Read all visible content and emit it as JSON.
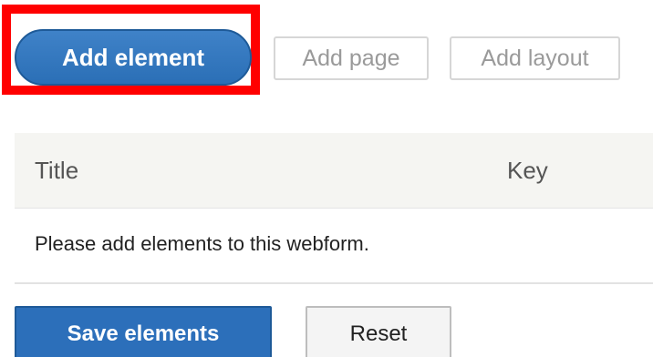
{
  "toolbar": {
    "add_element_label": "Add element",
    "add_page_label": "Add page",
    "add_layout_label": "Add layout"
  },
  "elements_table": {
    "columns": [
      "Title",
      "Key"
    ],
    "empty_message": "Please add elements to this webform."
  },
  "actions": {
    "save_label": "Save elements",
    "reset_label": "Reset"
  },
  "colors": {
    "highlight": "#ff0000",
    "primary": "#2c6fba",
    "header_bg": "#f5f5f2"
  }
}
